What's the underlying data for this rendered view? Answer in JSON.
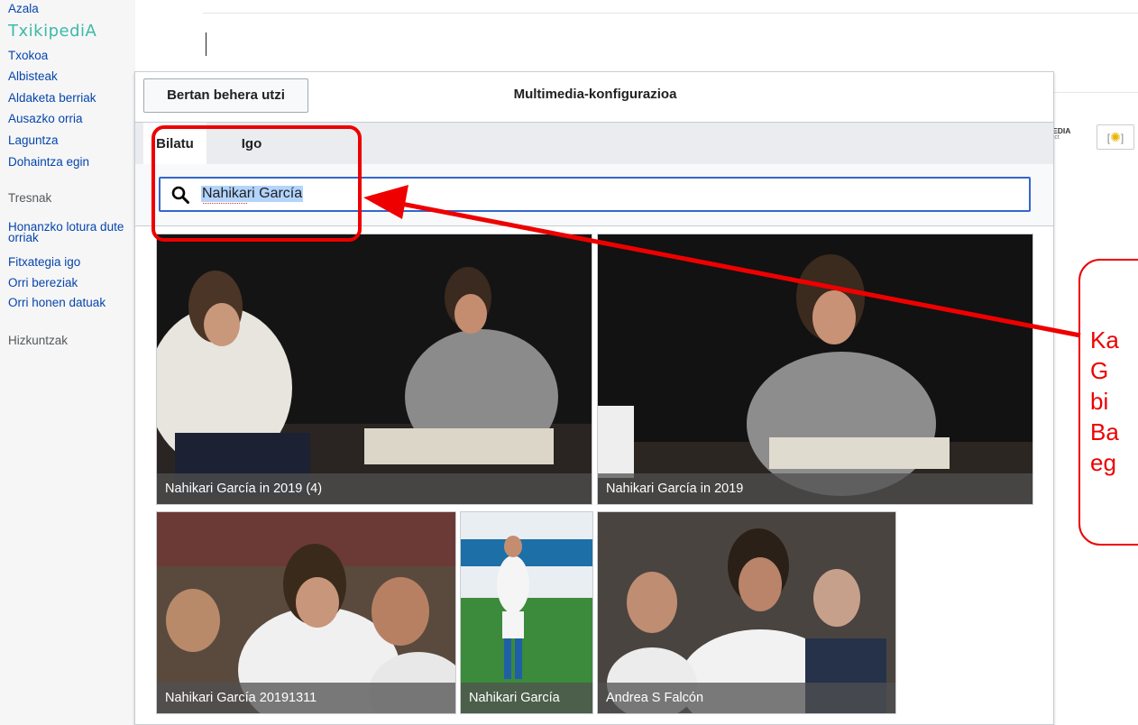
{
  "sidebar": {
    "brand": "TxikipediA",
    "nav": [
      "Azala",
      "Txokoa",
      "Albisteak",
      "Aldaketa berriak",
      "Ausazko orria",
      "Laguntza",
      "Dohaintza egin"
    ],
    "tools_heading": "Tresnak",
    "tools": [
      "Honanzko lotura dute orriak",
      "Fitxategia igo",
      "Orri bereziak",
      "Orri honen datuak"
    ],
    "languages_heading": "Hizkuntzak"
  },
  "dialog": {
    "cancel_label": "Bertan behera utzi",
    "title": "Multimedia-konfigurazioa",
    "tabs": [
      "Bilatu",
      "Igo"
    ],
    "search_value": "Nahikari García",
    "results": [
      {
        "caption": "Nahikari García in 2019 (4)"
      },
      {
        "caption": "Nahikari García in 2019"
      },
      {
        "caption": "Nahikari García 20191311"
      },
      {
        "caption": "Nahikari García"
      },
      {
        "caption": "Andrea S Falcón"
      }
    ]
  },
  "annotation": {
    "callout_text": "Ka\nG\nbi\nBa\neg",
    "color": "#ee0000"
  },
  "logos": {
    "wikimedia_small": "a",
    "wikimedia_big": "MEDIA",
    "wikimedia_sub": "oject"
  }
}
